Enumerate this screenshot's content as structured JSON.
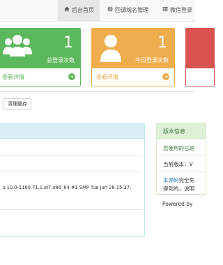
{
  "nav": {
    "tabs": [
      {
        "label": "后台首页",
        "icon": "home-icon"
      },
      {
        "label": "回调域名管理",
        "icon": "globe-icon"
      },
      {
        "label": "微信登录",
        "icon": "list-icon"
      }
    ]
  },
  "cards": [
    {
      "count": "1",
      "label": "总登录次数",
      "more": "查看详情",
      "icon": "users-icon",
      "color": "#5cb85c"
    },
    {
      "count": "1",
      "label": "今日登录次数",
      "more": "查看详情",
      "icon": "user-icon",
      "color": "#f0ad4e"
    },
    {
      "count": "",
      "label": "",
      "more": "",
      "icon": "",
      "color": "#d9534f"
    }
  ],
  "actions": {
    "clear_cache": "清理缓存"
  },
  "system": {
    "uname": "s.10.0-1160.71.1.el7.x86_64 #1 SMP Tue Jun 28 15:37:"
  },
  "version_panel": {
    "title": "版本信息",
    "used": "您使用的已是",
    "current": "当前版本：V",
    "source_link": "本源码",
    "source_rest": "完全免",
    "obtained": "得到的，说明",
    "powered": "Powered by"
  },
  "colors": {
    "green": "#5cb85c",
    "orange": "#f0ad4e",
    "red": "#d9534f",
    "link": "#337ab7",
    "panel_green_text": "#3c763d"
  }
}
